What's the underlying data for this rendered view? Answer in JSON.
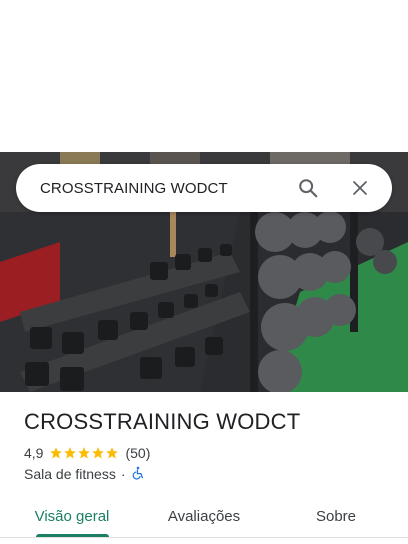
{
  "search": {
    "query": "CROSSTRAINING WODCT"
  },
  "place": {
    "name": "CROSSTRAINING WODCT",
    "rating": "4,9",
    "stars": 5,
    "review_count": "(50)",
    "category": "Sala de fitness",
    "separator": "·",
    "accessibility_icon": "wheelchair-icon"
  },
  "tabs": [
    {
      "label": "Visão geral",
      "active": true
    },
    {
      "label": "Avaliações",
      "active": false
    },
    {
      "label": "Sobre",
      "active": false
    }
  ],
  "colors": {
    "accent": "#1a7f64",
    "star": "#fbbc04",
    "accessibility": "#1a73e8"
  }
}
